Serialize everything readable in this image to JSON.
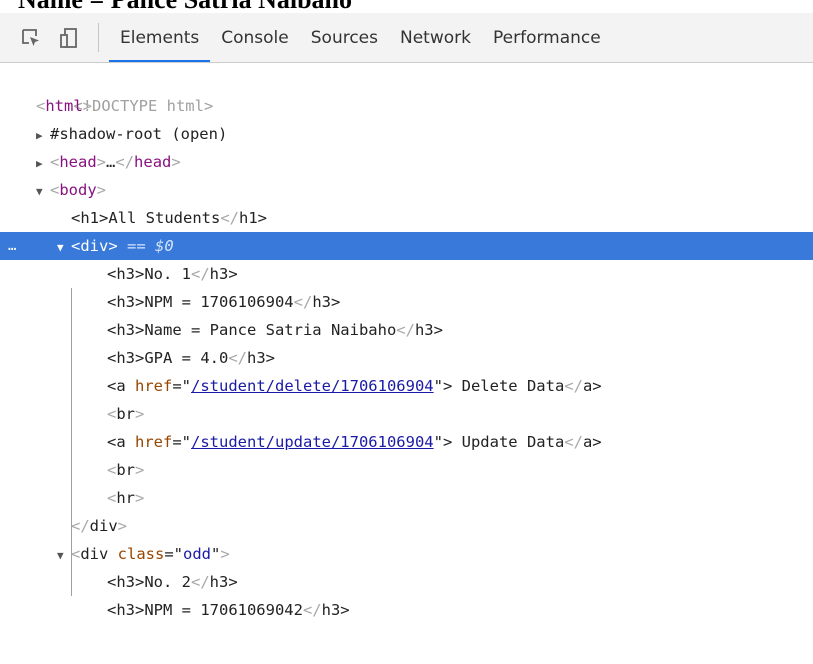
{
  "page": {
    "heading": "Name = Pance Satria Naibaho"
  },
  "toolbar": {
    "tabs": [
      "Elements",
      "Console",
      "Sources",
      "Network",
      "Performance"
    ],
    "active_tab": "Elements",
    "accent_color": "#1a73e8"
  },
  "dom": {
    "doctype": "<!DOCTYPE html>",
    "html_open": "html",
    "shadow_root": "#shadow-root (open)",
    "head_collapsed": "head",
    "head_ellipsis": "…",
    "body_open": "body",
    "h1_text": "All Students",
    "selected_div": "div",
    "selected_marker": "== $0",
    "selected_dots": "…",
    "students": [
      {
        "no": "No. 1",
        "npm": "NPM = 1706106904",
        "name": "Name = Pance Satria Naibaho",
        "gpa": "GPA = 4.0",
        "delete_href": "/student/delete/1706106904",
        "delete_text": " Delete Data",
        "update_href": "/student/update/1706106904",
        "update_text": " Update Data"
      },
      {
        "class": "odd",
        "no": "No. 2",
        "npm": "NPM = 17061069042"
      }
    ],
    "selection_color": "#3879d9"
  }
}
